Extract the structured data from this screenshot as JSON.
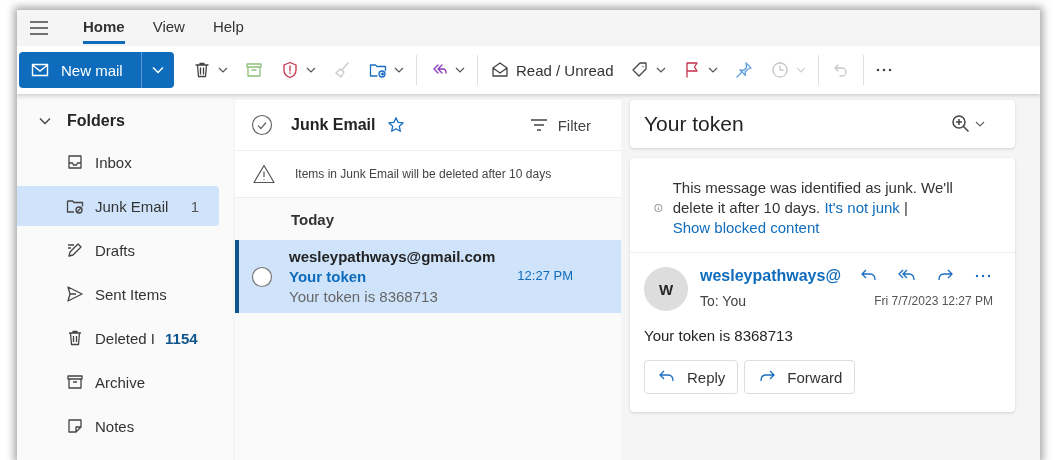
{
  "menu": {
    "tabs": [
      {
        "label": "Home",
        "selected": true
      },
      {
        "label": "View",
        "selected": false
      },
      {
        "label": "Help",
        "selected": false
      }
    ]
  },
  "toolbar": {
    "new_mail": {
      "label": "New mail"
    },
    "items": [
      {
        "kind": "delete",
        "caret": true,
        "disabled": false
      },
      {
        "kind": "archive",
        "caret": false,
        "disabled": false
      },
      {
        "kind": "report",
        "caret": true,
        "disabled": false
      },
      {
        "kind": "sweep",
        "caret": false,
        "disabled": true
      },
      {
        "kind": "move",
        "caret": true,
        "disabled": false
      },
      {
        "kind": "separator"
      },
      {
        "kind": "reply_all",
        "caret": true,
        "disabled": false
      },
      {
        "kind": "separator"
      },
      {
        "kind": "read_unread",
        "label": "Read / Unread",
        "caret": false,
        "disabled": false
      },
      {
        "kind": "tag",
        "caret": true,
        "disabled": false
      },
      {
        "kind": "flag",
        "caret": true,
        "disabled": false
      },
      {
        "kind": "pin",
        "caret": false,
        "disabled": false
      },
      {
        "kind": "snooze",
        "caret": true,
        "disabled": true
      },
      {
        "kind": "separator"
      },
      {
        "kind": "undo",
        "caret": false,
        "disabled": true
      },
      {
        "kind": "separator"
      },
      {
        "kind": "more",
        "caret": false,
        "disabled": false
      }
    ]
  },
  "sidebar": {
    "title": "Folders",
    "expanded": true,
    "items": [
      {
        "kind": "inbox",
        "label": "Inbox",
        "selected": false
      },
      {
        "kind": "junk",
        "label": "Junk Email",
        "count": "1",
        "unread": false,
        "selected": true
      },
      {
        "kind": "drafts",
        "label": "Drafts",
        "selected": false
      },
      {
        "kind": "sent",
        "label": "Sent Items",
        "selected": false
      },
      {
        "kind": "deleted",
        "label": "Deleted I",
        "count": "1154",
        "unread": true,
        "selected": false
      },
      {
        "kind": "archive",
        "label": "Archive",
        "selected": false
      },
      {
        "kind": "notes",
        "label": "Notes",
        "selected": false
      }
    ]
  },
  "message_list": {
    "title": "Junk Email",
    "filter": "Filter",
    "notice": "Items in Junk Email will be deleted after 10 days",
    "group": "Today",
    "messages": [
      {
        "sender": "wesleypathways@gmail.com",
        "subject": "Your token",
        "preview": "Your token is 8368713",
        "time": "12:27 PM",
        "selected": true
      }
    ]
  },
  "reading_pane": {
    "subject": "Your token",
    "junk_notice": {
      "text": "This message was identified as junk. We'll delete it after 10 days.",
      "link_1": "It's not junk",
      "separator": "|",
      "link_2": "Show blocked content"
    },
    "message": {
      "avatar": "W",
      "sender": "wesleypathways@",
      "to_label": "To:",
      "to": "You",
      "date": "Fri 7/7/2023 12:27 PM",
      "body": "Your token is 8368713"
    },
    "buttons": [
      "Reply",
      "Forward"
    ]
  }
}
